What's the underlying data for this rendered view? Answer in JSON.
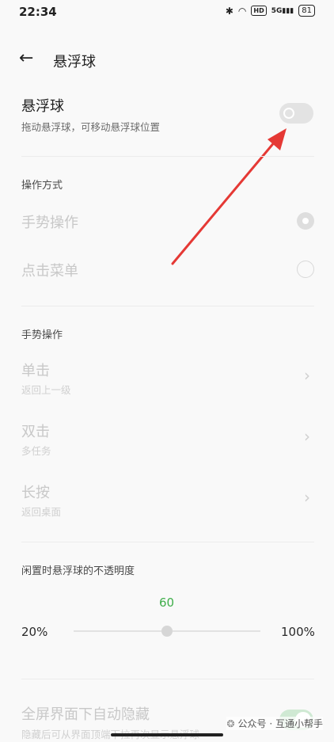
{
  "status_bar": {
    "time": "22:34",
    "network": "5G",
    "hd": "HD",
    "battery": "81"
  },
  "header": {
    "back_icon": "←",
    "title": "悬浮球"
  },
  "floating_ball": {
    "title": "悬浮球",
    "subtitle": "拖动悬浮球，可移动悬浮球位置",
    "enabled": false
  },
  "operation_mode": {
    "section_title": "操作方式",
    "options": [
      {
        "label": "手势操作",
        "selected": true
      },
      {
        "label": "点击菜单",
        "selected": false
      }
    ]
  },
  "gestures": {
    "section_title": "手势操作",
    "items": [
      {
        "label": "单击",
        "value": "返回上一级"
      },
      {
        "label": "双击",
        "value": "多任务"
      },
      {
        "label": "长按",
        "value": "返回桌面"
      }
    ]
  },
  "opacity": {
    "section_title": "闲置时悬浮球的不透明度",
    "value": "60",
    "min_label": "20%",
    "max_label": "100%",
    "value_color": "#3fae4a"
  },
  "auto_hide": {
    "title": "全屏界面下自动隐藏",
    "subtitle": "隐藏后可从界面顶端下拉再次显示悬浮球",
    "enabled": true
  },
  "watermark": "公众号 · 互通小帮手",
  "annotation_color": "#e53935"
}
